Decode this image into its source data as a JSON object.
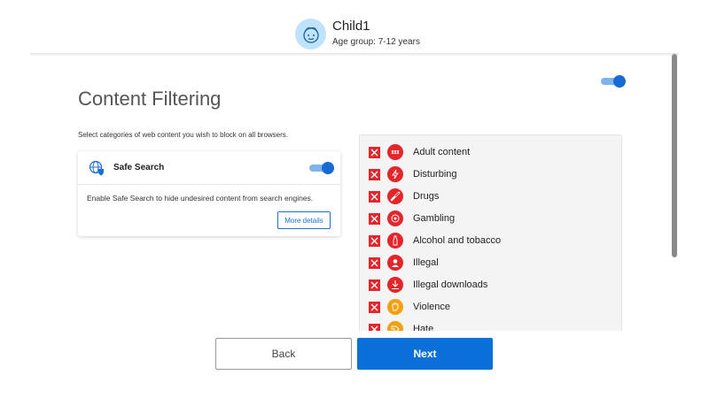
{
  "profile": {
    "name": "Child1",
    "age_group": "Age group: 7-12 years",
    "avatar_icon": "child-face-icon"
  },
  "content_filtering": {
    "title": "Content Filtering",
    "enabled": true,
    "intro": "Select categories of web content you wish to block on all browsers."
  },
  "safe_search": {
    "title": "Safe Search",
    "enabled": true,
    "description": "Enable Safe Search to hide undesired content from search engines.",
    "more_details_label": "More details"
  },
  "categories": [
    {
      "label": "Adult content",
      "blocked": true,
      "icon": "adult-icon",
      "color": "#e3262b"
    },
    {
      "label": "Disturbing",
      "blocked": true,
      "icon": "disturbing-icon",
      "color": "#e3262b"
    },
    {
      "label": "Drugs",
      "blocked": true,
      "icon": "drugs-icon",
      "color": "#e3262b"
    },
    {
      "label": "Gambling",
      "blocked": true,
      "icon": "gambling-icon",
      "color": "#e3262b"
    },
    {
      "label": "Alcohol and tobacco",
      "blocked": true,
      "icon": "alcohol-icon",
      "color": "#e3262b"
    },
    {
      "label": "Illegal",
      "blocked": true,
      "icon": "illegal-icon",
      "color": "#e3262b"
    },
    {
      "label": "Illegal downloads",
      "blocked": true,
      "icon": "download-icon",
      "color": "#e3262b"
    },
    {
      "label": "Violence",
      "blocked": true,
      "icon": "violence-icon",
      "color": "#f0a010"
    },
    {
      "label": "Hate",
      "blocked": true,
      "icon": "hate-icon",
      "color": "#f0a010"
    }
  ],
  "footer": {
    "back_label": "Back",
    "next_label": "Next"
  },
  "colors": {
    "accent": "#0a6fd8",
    "blocked": "#e3262b",
    "warning": "#f0a010"
  }
}
